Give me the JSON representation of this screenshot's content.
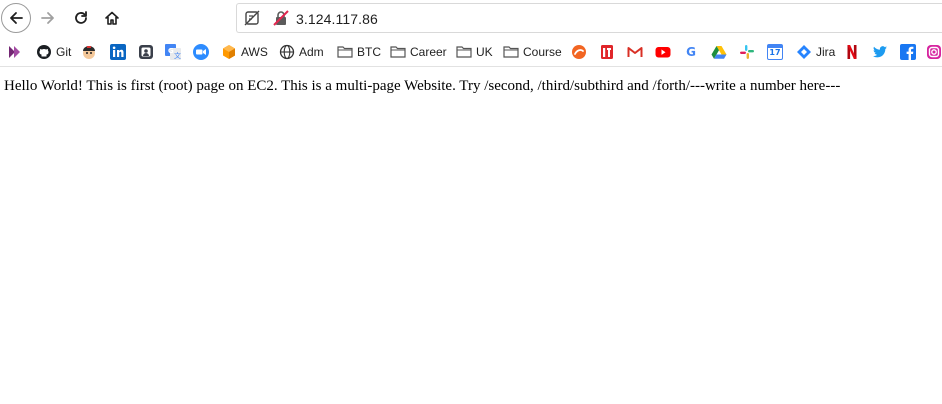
{
  "browser": {
    "url": "3.124.117.86",
    "nav": {
      "back_icon": "arrow-left-icon",
      "forward_icon": "arrow-right-icon",
      "reload_icon": "reload-icon",
      "home_icon": "home-icon"
    },
    "urlbar_icons": [
      "permissions-icon",
      "insecure-lock-icon"
    ]
  },
  "bookmarks": {
    "items": [
      {
        "label": "",
        "icon": "powerapps-icon"
      },
      {
        "label": "Git",
        "icon": "github-icon"
      },
      {
        "label": "",
        "icon": "avatar-icon"
      },
      {
        "label": "",
        "icon": "linkedin-icon"
      },
      {
        "label": "",
        "icon": "contacts-icon"
      },
      {
        "label": "",
        "icon": "translate-icon"
      },
      {
        "label": "",
        "icon": "zoom-icon"
      },
      {
        "label": "AWS",
        "icon": "aws-icon"
      },
      {
        "label": "Adm",
        "icon": "globe-icon"
      },
      {
        "label": "BTC",
        "icon": "folder-icon"
      },
      {
        "label": "Career",
        "icon": "folder-icon"
      },
      {
        "label": "UK",
        "icon": "folder-icon"
      },
      {
        "label": "Course",
        "icon": "folder-icon"
      },
      {
        "label": "",
        "icon": "orange-swirl-icon"
      },
      {
        "label": "",
        "icon": "red-app-icon"
      },
      {
        "label": "",
        "icon": "gmail-icon"
      },
      {
        "label": "",
        "icon": "youtube-icon"
      },
      {
        "label": "",
        "icon": "google-icon"
      },
      {
        "label": "",
        "icon": "drive-icon"
      },
      {
        "label": "",
        "icon": "slack-icon"
      },
      {
        "label": "",
        "icon": "calendar-icon"
      },
      {
        "label": "Jira",
        "icon": "jira-icon"
      },
      {
        "label": "",
        "icon": "netflix-icon"
      },
      {
        "label": "",
        "icon": "twitter-icon"
      },
      {
        "label": "",
        "icon": "facebook-icon"
      },
      {
        "label": "",
        "icon": "instagram-icon"
      }
    ],
    "calendar_day": "17"
  },
  "page": {
    "text": "Hello World! This is first (root) page on EC2. This is a multi-page Website. Try /second, /third/subthird and /forth/---write a number here---"
  },
  "colors": {
    "linkedin": "#0a66c2",
    "youtube": "#ff0000",
    "netflix": "#e50914",
    "twitter": "#1d9bf0",
    "facebook": "#1877f2",
    "aws": "#ff9900",
    "jira": "#2684ff"
  }
}
